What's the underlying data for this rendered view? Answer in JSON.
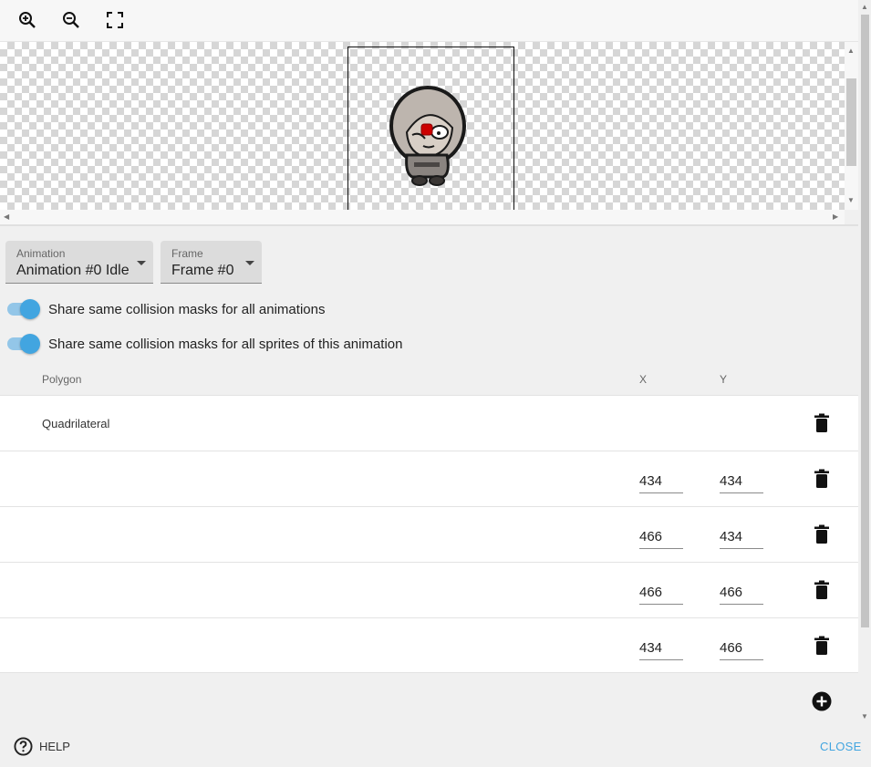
{
  "toolbar": {
    "icons": [
      "zoom-in-icon",
      "zoom-out-icon",
      "fit-to-screen-icon"
    ]
  },
  "colors": {
    "accent": "#42a5e0",
    "toggle_track": "#93c6e8",
    "select_bg": "#dcdcdc"
  },
  "selectors": {
    "animation": {
      "label": "Animation",
      "value": "Animation #0 Idle"
    },
    "frame": {
      "label": "Frame",
      "value": "Frame #0"
    }
  },
  "toggles": [
    {
      "label": "Share same collision masks for all animations",
      "on": true
    },
    {
      "label": "Share same collision masks for all sprites of this animation",
      "on": true
    }
  ],
  "table": {
    "headers": {
      "polygon": "Polygon",
      "x": "X",
      "y": "Y"
    },
    "polygon_name": "Quadrilateral",
    "vertices": [
      {
        "x": "434",
        "y": "434"
      },
      {
        "x": "466",
        "y": "434"
      },
      {
        "x": "466",
        "y": "466"
      },
      {
        "x": "434",
        "y": "466"
      }
    ]
  },
  "footer": {
    "help_label": "HELP",
    "close_label": "CLOSE"
  }
}
